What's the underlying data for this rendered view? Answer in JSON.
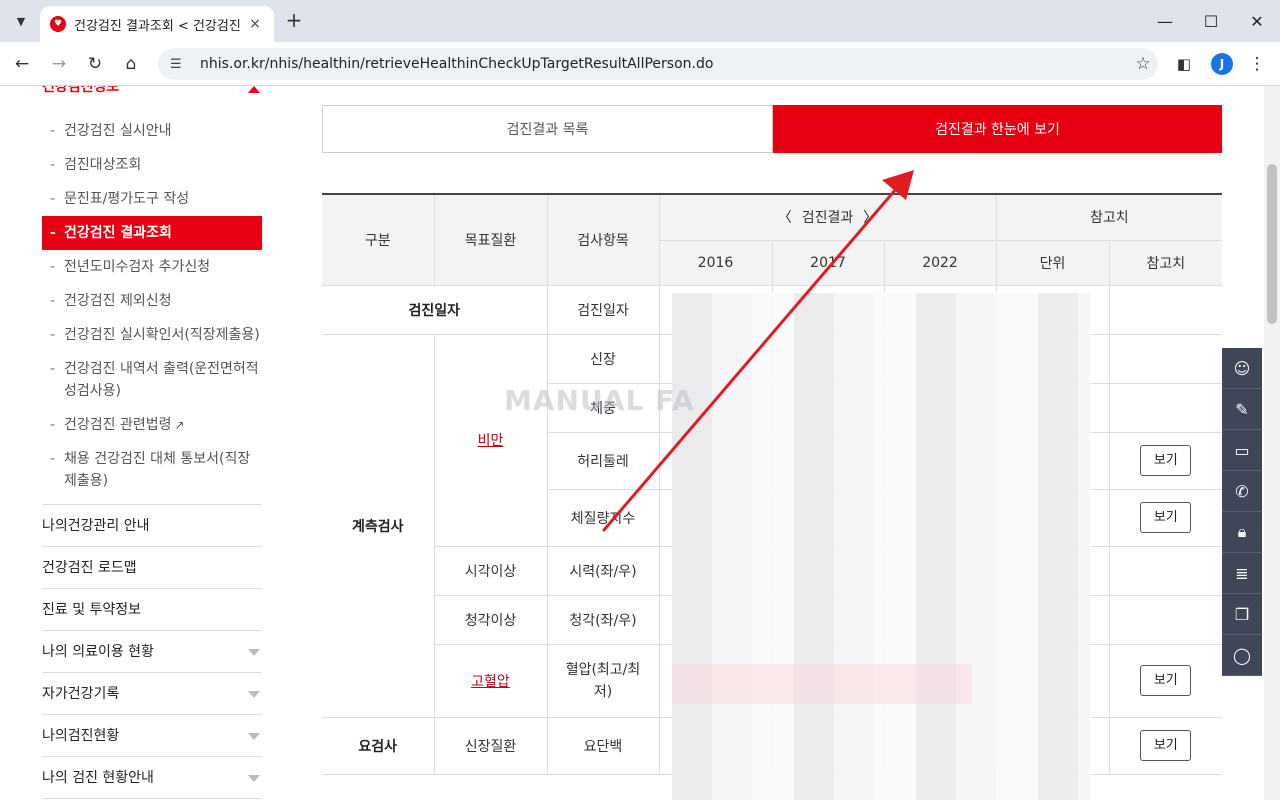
{
  "browser": {
    "tab_title": "건강검진 결과조회 < 건강검진",
    "tab_close": "×",
    "new_tab": "+",
    "url": "nhis.or.kr/nhis/healthin/retrieveHealthinCheckUpTargetResultAllPerson.do",
    "profile_initial": "J",
    "win_minimize": "—",
    "win_maximize": "☐",
    "win_close": "✕"
  },
  "sidebar": {
    "section_title": "건강검진정보",
    "sub_items": [
      {
        "label": "건강검진 실시안내"
      },
      {
        "label": "검진대상조회"
      },
      {
        "label": "문진표/평가도구 작성"
      },
      {
        "label": "건강검진 결과조회",
        "active": true
      },
      {
        "label": "전년도미수검자 추가신청"
      },
      {
        "label": "건강검진 제외신청"
      },
      {
        "label": "건강검진 실시확인서(직장제출용)"
      },
      {
        "label": "건강검진 내역서 출력(운전면허적성검사용)"
      },
      {
        "label": "건강검진 관련법령"
      },
      {
        "label": "채용 건강검진 대체 통보서(직장제출용)"
      }
    ],
    "menu_items": [
      {
        "label": "나의건강관리 안내",
        "has_arrow": false
      },
      {
        "label": "건강검진 로드맵",
        "has_arrow": false
      },
      {
        "label": "진료 및 투약정보",
        "has_arrow": false
      },
      {
        "label": "나의 의료이용 현황",
        "has_arrow": true
      },
      {
        "label": "자가건강기록",
        "has_arrow": true
      },
      {
        "label": "나의검진현황",
        "has_arrow": true
      },
      {
        "label": "나의 검진 현황안내",
        "has_arrow": true
      }
    ]
  },
  "tabs": {
    "list_label": "검진결과 목록",
    "overview_label": "검진결과 한눈에 보기"
  },
  "table": {
    "headers": {
      "category": "구분",
      "target_disease": "목표질환",
      "test_item": "검사항목",
      "results": "검진결과",
      "reference": "참고치",
      "years": [
        "2016",
        "2017",
        "2022"
      ],
      "unit": "단위",
      "reference_value": "참고치"
    },
    "rows": {
      "exam_date_cat": "검진일자",
      "exam_date_item": "검진일자",
      "measure_cat": "계측검사",
      "obesity": "비만",
      "height": "신장",
      "weight": "체중",
      "waist": "허리둘레",
      "bmi": "체질량지수",
      "vision_disease": "시각이상",
      "vision": "시력(좌/우)",
      "hearing_disease": "청각이상",
      "hearing": "청각(좌/우)",
      "hypertension": "고혈압",
      "bp": "혈압(최고/최저)",
      "urine_cat": "요검사",
      "kidney": "신장질환",
      "protein": "요단백"
    },
    "see_label": "보기"
  },
  "watermark": "MANUAL FA",
  "quickbar_icons": [
    "person-icon",
    "bookmark-icon",
    "monitor-icon",
    "phone-icon",
    "lock-icon",
    "document-icon",
    "copy-icon",
    "chat-icon"
  ],
  "colors": {
    "accent": "#e60012",
    "quickbar": "#3e4657"
  }
}
